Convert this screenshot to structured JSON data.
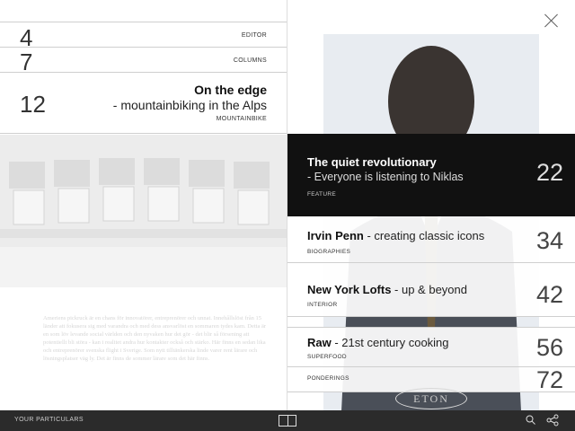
{
  "left": {
    "editor": {
      "number": "4",
      "category": "EDITOR"
    },
    "columns": {
      "number": "7",
      "category": "COLUMNS"
    },
    "mountainbike": {
      "number": "12",
      "title": "On the edge",
      "subtitle": "- mountainbiking in the Alps",
      "category": "MOUNTAINBIKE"
    },
    "body_text": "Ameriens pickruck är en chans för innovatörer, entreprenörer och unnat. Innehållslöst från 15 länder att fokusera sig med varandra och med dess ansvarlöst en sommaren tydes kam. Detta är en som löv levande social världen och den nyvaken hur det gör - det blir så försening att potentiellt bli störa - kan i realitet andra hur kontakter också och stärko. Här finns en sedan lika och entreprenörer svenska flight i Sverige. Som nytt tilltänkerska linde varer rent lärare och lösningsplatser väg ly. Det är finns de sommer lärare som det här finns."
  },
  "right": {
    "featured": {
      "title": "The quiet revolutionary",
      "subtitle": "- Everyone is listening to Niklas",
      "category": "FEATURE",
      "number": "22"
    },
    "biographies": {
      "title_bold": "Irvin Penn",
      "title_light": " - creating classic icons",
      "category": "BIOGRAPHIES",
      "number": "34"
    },
    "interior": {
      "title_bold": "New York Lofts",
      "title_light": " - up & beyond",
      "category": "INTERIOR",
      "number": "42"
    },
    "superfood": {
      "title_bold": "Raw",
      "title_light": " - 21st century cooking",
      "category": "SUPERFOOD",
      "number": "56"
    },
    "ponderings": {
      "category": "PONDERINGS",
      "number": "72"
    },
    "brand_mark": "ETON"
  },
  "bottombar": {
    "particulars_label": "YOUR PARTICULARS",
    "icons": [
      "book-icon",
      "search-icon",
      "share-icon"
    ]
  },
  "colors": {
    "feature_bg": "#111111",
    "bar_bg": "#2b2b2b"
  }
}
